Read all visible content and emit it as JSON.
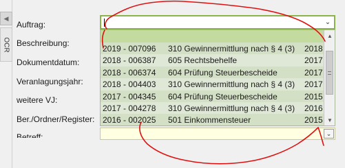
{
  "side": {
    "ocr_tab": "OCR",
    "scroll_arrow": "◀"
  },
  "labels": {
    "auftrag": "Auftrag:",
    "beschreibung": "Beschreibung:",
    "dokumentdatum": "Dokumentdatum:",
    "veranlagungsjahr": "Veranlagungsjahr:",
    "weitere_vj": "weitere VJ:",
    "ber_ordner": "Ber./Ordner/Register:",
    "betreff": "Betreff:"
  },
  "auftrag_combo": {
    "value": "",
    "arrow": "⌄"
  },
  "dropdown": {
    "rows": [
      {
        "nr": "2019 - 007096",
        "desc": "310 Gewinnermittlung nach  § 4 (3)",
        "year": "2018"
      },
      {
        "nr": "2018 - 006387",
        "desc": "605 Rechtsbehelfe",
        "year": "2017"
      },
      {
        "nr": "2018 - 006374",
        "desc": "604 Prüfung Steuerbescheide",
        "year": "2017"
      },
      {
        "nr": "2018 - 004403",
        "desc": "310 Gewinnermittlung nach  § 4 (3)",
        "year": "2017"
      },
      {
        "nr": "2017 - 004345",
        "desc": "604 Prüfung Steuerbescheide",
        "year": "2015"
      },
      {
        "nr": "2017 - 004278",
        "desc": "310 Gewinnermittlung nach  § 4 (3)",
        "year": "2016"
      },
      {
        "nr": "2016 - 002025",
        "desc": "501 Einkommensteuer",
        "year": "2015"
      }
    ],
    "scroll_up": "▲",
    "scroll_down": "▼"
  },
  "betreff_combo": {
    "arrow": "⌄"
  },
  "colors": {
    "accent_border": "#8ab34a",
    "header_green": "#c4dba0",
    "list_bg": "#dfe8d6",
    "annotation_red": "#e01010"
  }
}
